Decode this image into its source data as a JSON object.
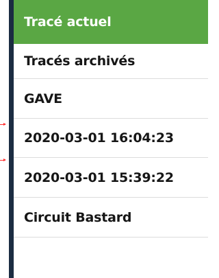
{
  "tracks_menu": {
    "items": [
      {
        "label": "Tracé actuel",
        "selected": true
      },
      {
        "label": "Tracés archivés",
        "selected": false
      },
      {
        "label": "GAVE",
        "selected": false
      },
      {
        "label": "2020-03-01 16:04:23",
        "selected": false
      },
      {
        "label": "2020-03-01 15:39:22",
        "selected": false
      },
      {
        "label": "Circuit Bastard",
        "selected": false
      }
    ]
  },
  "colors": {
    "selected_bg": "#5aa744",
    "frame": "#1b2c42",
    "pointer": "#ff2a2a"
  }
}
